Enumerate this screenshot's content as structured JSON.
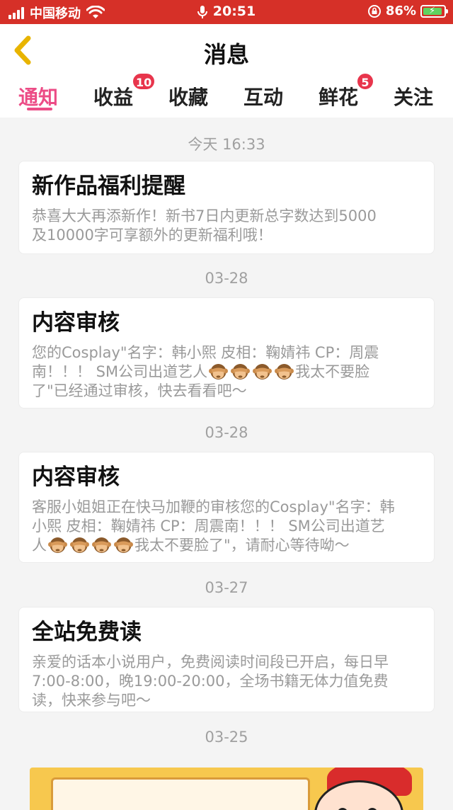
{
  "status_bar": {
    "carrier": "中国移动",
    "time": "20:51",
    "battery": "86%"
  },
  "nav": {
    "title": "消息"
  },
  "tabs": [
    {
      "label": "通知",
      "active": true
    },
    {
      "label": "收益",
      "badge": "10"
    },
    {
      "label": "收藏"
    },
    {
      "label": "互动"
    },
    {
      "label": "鲜花",
      "badge": "5"
    },
    {
      "label": "关注"
    }
  ],
  "messages": [
    {
      "date": "今天 16:33",
      "title": "新作品福利提醒",
      "body_lines": [
        "恭喜大大再添新作！新书7日内更新总字数达到5000",
        "及10000字可享额外的更新福利哦！"
      ]
    },
    {
      "date": "03-28",
      "title": "内容审核",
      "body_parts": {
        "line1": "您的Cosplay\"名字：韩小熙 皮相：鞠婧祎 CP：周震",
        "line2_pre": "南！！！ SM公司出道艺人",
        "line2_post": "我太不要脸",
        "line3": "了\"已经通过审核，快去看看吧～"
      }
    },
    {
      "date": "03-28",
      "title": "内容审核",
      "body_parts": {
        "line1": "客服小姐姐正在快马加鞭的审核您的Cosplay\"名字：韩",
        "line2": "小熙 皮相：鞠婧祎 CP：周震南！！！ SM公司出道艺",
        "line3_pre": "人",
        "line3_post": "我太不要脸了\"，请耐心等待呦～"
      }
    },
    {
      "date": "03-27",
      "title": "全站免费读",
      "body_lines": [
        "亲爱的话本小说用户，免费阅读时间段已开启，每日早",
        "7:00-8:00，晚19:00-20:00，全场书籍无体力值免费",
        "读，快来参与吧～"
      ]
    },
    {
      "date": "03-25"
    }
  ],
  "colors": {
    "status_bar_bg": "#d63028",
    "accent_pink": "#ec4c86",
    "badge_red": "#e8354c",
    "back_arrow": "#e8b400"
  }
}
